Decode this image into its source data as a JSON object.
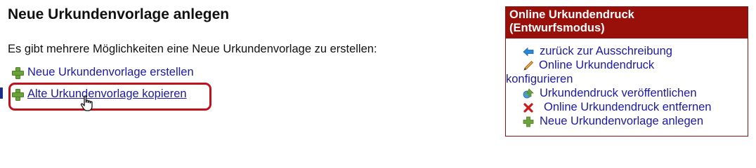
{
  "page": {
    "title": "Neue Urkundenvorlage anlegen",
    "intro": "Es gibt mehrere Möglichkeiten eine Neue Urkundenvorlage zu erstellen:"
  },
  "options": [
    {
      "label": "Neue Urkundenvorlage erstellen",
      "icon": "plus-icon"
    },
    {
      "label": "Alte Urkundenvorlage kopieren",
      "icon": "plus-icon",
      "highlighted": true
    }
  ],
  "sidebar": {
    "title_line1": "Online Urkundendruck",
    "title_line2": "(Entwurfsmodus)",
    "items": [
      {
        "label": "zurück zur Ausschreibung",
        "icon": "arrow-left-icon"
      },
      {
        "label_line1": "Online Urkundendruck",
        "label_line2": "konfigurieren",
        "icon": "pencil-icon"
      },
      {
        "label": "Urkundendruck veröffentlichen",
        "icon": "publish-icon"
      },
      {
        "label": "Online Urkundendruck entfernen",
        "icon": "delete-icon"
      },
      {
        "label": "Neue Urkundenvorlage anlegen",
        "icon": "plus-icon"
      }
    ]
  },
  "colors": {
    "link": "#1a1aa6",
    "sidebar_header": "#990f0a",
    "highlight": "#c0121a",
    "plus": "#6aa33a"
  }
}
